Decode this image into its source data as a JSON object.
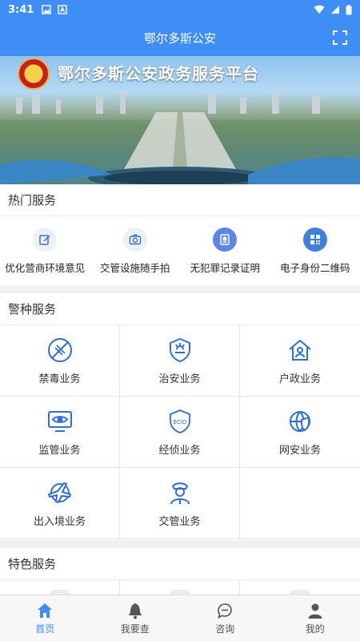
{
  "status_bar": {
    "time": "3:41"
  },
  "header": {
    "title": "鄂尔多斯公安"
  },
  "banner": {
    "headline": "鄂尔多斯公安政务服务平台"
  },
  "hot_services": {
    "title": "热门服务",
    "items": [
      {
        "label": "优化营商环境意见",
        "icon": "edit-icon"
      },
      {
        "label": "交管设施随手拍",
        "icon": "camera-icon"
      },
      {
        "label": "无犯罪记录证明",
        "icon": "certificate-icon"
      },
      {
        "label": "电子身份二维码",
        "icon": "qrcode-icon"
      }
    ]
  },
  "police_services": {
    "title": "警种服务",
    "items": [
      {
        "label": "禁毒业务",
        "icon": "no-drugs-icon"
      },
      {
        "label": "治安业务",
        "icon": "shield-badge-icon"
      },
      {
        "label": "户政业务",
        "icon": "household-icon"
      },
      {
        "label": "监管业务",
        "icon": "monitor-eye-icon"
      },
      {
        "label": "经侦业务",
        "icon": "ecid-shield-icon",
        "icon_text": "ECID"
      },
      {
        "label": "网安业务",
        "icon": "cyber-shield-icon"
      },
      {
        "label": "出入境业务",
        "icon": "airplane-icon"
      },
      {
        "label": "交管业务",
        "icon": "traffic-officer-icon"
      }
    ]
  },
  "featured_services": {
    "title": "特色服务"
  },
  "tabbar": {
    "items": [
      {
        "label": "首页",
        "icon": "home-icon",
        "active": true
      },
      {
        "label": "我要查",
        "icon": "bell-icon",
        "active": false
      },
      {
        "label": "咨询",
        "icon": "chat-icon",
        "active": false
      },
      {
        "label": "我的",
        "icon": "user-icon",
        "active": false
      }
    ]
  },
  "colors": {
    "primary": "#3f8ef5",
    "icon_blue": "#2f6fd6",
    "background": "#eef0f3"
  }
}
